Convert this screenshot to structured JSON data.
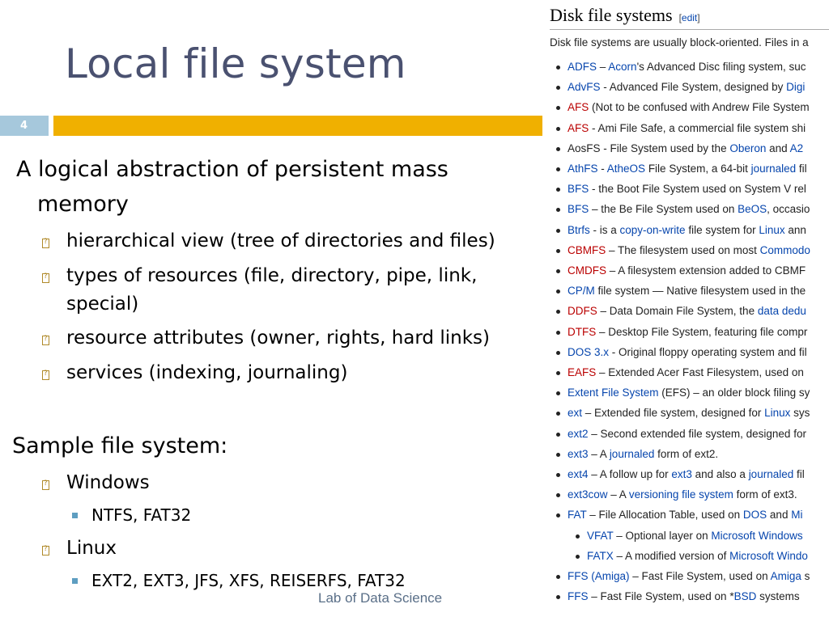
{
  "slide": {
    "title": "Local file system",
    "slide_number": "4",
    "footer": "Lab of Data Science",
    "intro_line1": "A logical abstraction of persistent mass",
    "intro_line2": "memory",
    "bullets": [
      {
        "line1": "hierarchical view (tree of directories and files)"
      },
      {
        "line1": "types of resources (file, directory, pipe, link,",
        "line2": "special)"
      },
      {
        "line1": "resource attributes (owner, rights, hard links)"
      },
      {
        "line1": "services (indexing, journaling)"
      }
    ],
    "sample_heading": "Sample file system:",
    "windows_label": "Windows",
    "windows_fs": "NTFS, FAT32",
    "linux_label": "Linux",
    "linux_fs": "EXT2, EXT3, JFS, XFS, REISERFS, FAT32"
  },
  "wiki": {
    "heading": "Disk file systems",
    "edit_open": "[",
    "edit_label": "edit",
    "edit_close": "]",
    "intro": "Disk file systems are usually block-oriented. Files in a",
    "items": [
      {
        "parts": [
          {
            "t": "ADFS",
            "c": "lnk"
          },
          {
            "t": " – "
          },
          {
            "t": "Acorn",
            "c": "lnk"
          },
          {
            "t": "'s Advanced Disc filing system, suc"
          }
        ]
      },
      {
        "parts": [
          {
            "t": "AdvFS",
            "c": "lnk"
          },
          {
            "t": " - Advanced File System, designed by "
          },
          {
            "t": "Digi",
            "c": "lnk"
          }
        ]
      },
      {
        "parts": [
          {
            "t": "AFS",
            "c": "new"
          },
          {
            "t": " (Not to be confused with Andrew File System"
          }
        ]
      },
      {
        "parts": [
          {
            "t": "AFS",
            "c": "new"
          },
          {
            "t": " - Ami File Safe, a commercial file system shi"
          }
        ]
      },
      {
        "parts": [
          {
            "t": "AosFS - File System used by the "
          },
          {
            "t": "Oberon",
            "c": "lnk"
          },
          {
            "t": " and "
          },
          {
            "t": "A2",
            "c": "lnk"
          }
        ]
      },
      {
        "parts": [
          {
            "t": "AthFS",
            "c": "lnk"
          },
          {
            "t": " - "
          },
          {
            "t": "AtheOS",
            "c": "lnk"
          },
          {
            "t": " File System, a 64-bit "
          },
          {
            "t": "journaled",
            "c": "lnk"
          },
          {
            "t": " fil"
          }
        ]
      },
      {
        "parts": [
          {
            "t": "BFS",
            "c": "lnk"
          },
          {
            "t": " - the Boot File System used on System V rel"
          }
        ]
      },
      {
        "parts": [
          {
            "t": "BFS",
            "c": "lnk"
          },
          {
            "t": " – the Be File System used on "
          },
          {
            "t": "BeOS",
            "c": "lnk"
          },
          {
            "t": ", occasio"
          }
        ]
      },
      {
        "parts": [
          {
            "t": "Btrfs",
            "c": "lnk"
          },
          {
            "t": " - is a "
          },
          {
            "t": "copy-on-write",
            "c": "lnk"
          },
          {
            "t": " file system for "
          },
          {
            "t": "Linux",
            "c": "lnk"
          },
          {
            "t": " ann"
          }
        ]
      },
      {
        "parts": [
          {
            "t": "CBMFS",
            "c": "new"
          },
          {
            "t": " – The filesystem used on most "
          },
          {
            "t": "Commodo",
            "c": "lnk"
          }
        ]
      },
      {
        "parts": [
          {
            "t": "CMDFS",
            "c": "new"
          },
          {
            "t": " – A filesystem extension added to CBMF"
          }
        ]
      },
      {
        "parts": [
          {
            "t": "CP/M",
            "c": "lnk"
          },
          {
            "t": " file system — Native filesystem used in the"
          }
        ]
      },
      {
        "parts": [
          {
            "t": "DDFS",
            "c": "new"
          },
          {
            "t": " – Data Domain File System, the "
          },
          {
            "t": "data dedu",
            "c": "lnk"
          }
        ]
      },
      {
        "parts": [
          {
            "t": "DTFS",
            "c": "new"
          },
          {
            "t": " – Desktop File System, featuring file compr"
          }
        ]
      },
      {
        "parts": [
          {
            "t": "DOS 3.x",
            "c": "lnk"
          },
          {
            "t": " - Original floppy operating system and fil"
          }
        ]
      },
      {
        "parts": [
          {
            "t": "EAFS",
            "c": "new"
          },
          {
            "t": " – Extended Acer Fast Filesystem, used on"
          }
        ]
      },
      {
        "parts": [
          {
            "t": "Extent File System",
            "c": "lnk"
          },
          {
            "t": " (EFS) – an older block filing sy"
          }
        ]
      },
      {
        "parts": [
          {
            "t": "ext",
            "c": "lnk"
          },
          {
            "t": " – Extended file system, designed for "
          },
          {
            "t": "Linux",
            "c": "lnk"
          },
          {
            "t": " sys"
          }
        ]
      },
      {
        "parts": [
          {
            "t": "ext2",
            "c": "lnk"
          },
          {
            "t": " – Second extended file system, designed for"
          }
        ]
      },
      {
        "parts": [
          {
            "t": "ext3",
            "c": "lnk"
          },
          {
            "t": " – A "
          },
          {
            "t": "journaled",
            "c": "lnk"
          },
          {
            "t": " form of ext2."
          }
        ]
      },
      {
        "parts": [
          {
            "t": "ext4",
            "c": "lnk"
          },
          {
            "t": " – A follow up for "
          },
          {
            "t": "ext3",
            "c": "lnk"
          },
          {
            "t": " and also a "
          },
          {
            "t": "journaled",
            "c": "lnk"
          },
          {
            "t": " fil"
          }
        ]
      },
      {
        "parts": [
          {
            "t": "ext3cow",
            "c": "lnk"
          },
          {
            "t": " – A "
          },
          {
            "t": "versioning file system",
            "c": "lnk"
          },
          {
            "t": " form of ext3."
          }
        ]
      },
      {
        "parts": [
          {
            "t": "FAT",
            "c": "lnk"
          },
          {
            "t": " – File Allocation Table, used on "
          },
          {
            "t": "DOS",
            "c": "lnk"
          },
          {
            "t": " and "
          },
          {
            "t": "Mi",
            "c": "lnk"
          }
        ]
      },
      {
        "sub": true,
        "parts": [
          {
            "t": "VFAT",
            "c": "lnk"
          },
          {
            "t": " – Optional layer on "
          },
          {
            "t": "Microsoft Windows",
            "c": "lnk"
          }
        ]
      },
      {
        "sub": true,
        "parts": [
          {
            "t": "FATX",
            "c": "lnk"
          },
          {
            "t": " – A modified version of "
          },
          {
            "t": "Microsoft Windo",
            "c": "lnk"
          }
        ]
      },
      {
        "parts": [
          {
            "t": "FFS (Amiga)",
            "c": "lnk"
          },
          {
            "t": " – Fast File System, used on "
          },
          {
            "t": "Amiga",
            "c": "lnk"
          },
          {
            "t": " s"
          }
        ]
      },
      {
        "parts": [
          {
            "t": "FFS",
            "c": "lnk"
          },
          {
            "t": " – Fast File System, used on *"
          },
          {
            "t": "BSD",
            "c": "lnk"
          },
          {
            "t": " systems"
          }
        ]
      }
    ]
  }
}
